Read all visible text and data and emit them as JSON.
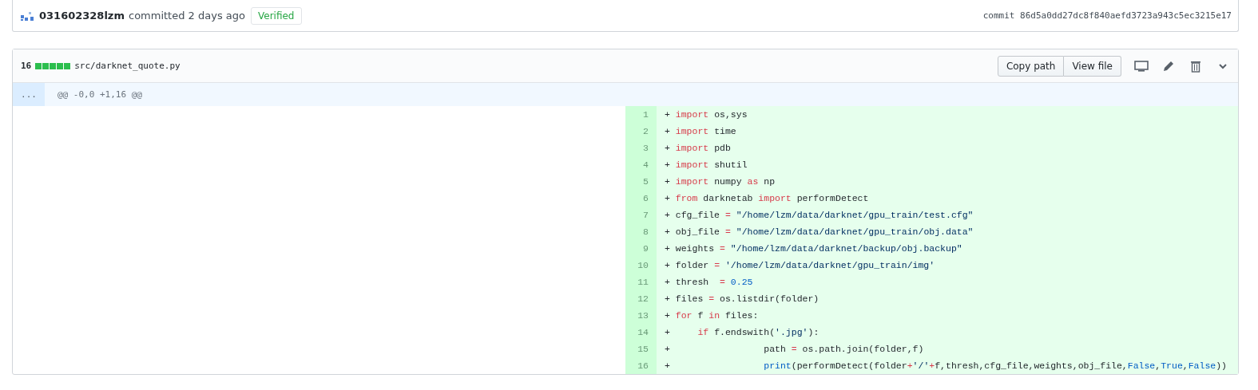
{
  "commit": {
    "author": "031602328lzm",
    "action": "committed 2 days ago",
    "badge": "Verified",
    "hash": "commit 86d5a0dd27dc8f840aefd3723a943c5ec3215e17"
  },
  "file": {
    "count": "16",
    "diffstat": [
      {
        "kind": "added"
      },
      {
        "kind": "added"
      },
      {
        "kind": "added"
      },
      {
        "kind": "added"
      },
      {
        "kind": "added"
      }
    ],
    "path": "src/darknet_quote.py",
    "buttons": [
      "Copy path",
      "View file"
    ]
  },
  "hunk": {
    "expander": "...",
    "header": "@@ -0,0 +1,16 @@"
  },
  "lines": [
    {
      "number": "1",
      "marker": "+",
      "tokens": [
        {
          "kind": "kw",
          "text": "import"
        },
        {
          "kind": "plain",
          "text": " os,sys"
        }
      ]
    },
    {
      "number": "2",
      "marker": "+",
      "tokens": [
        {
          "kind": "kw",
          "text": "import"
        },
        {
          "kind": "plain",
          "text": " time"
        }
      ]
    },
    {
      "number": "3",
      "marker": "+",
      "tokens": [
        {
          "kind": "kw",
          "text": "import"
        },
        {
          "kind": "plain",
          "text": " pdb"
        }
      ]
    },
    {
      "number": "4",
      "marker": "+",
      "tokens": [
        {
          "kind": "kw",
          "text": "import"
        },
        {
          "kind": "plain",
          "text": " shutil"
        }
      ]
    },
    {
      "number": "5",
      "marker": "+",
      "tokens": [
        {
          "kind": "kw",
          "text": "import"
        },
        {
          "kind": "plain",
          "text": " numpy "
        },
        {
          "kind": "kw",
          "text": "as"
        },
        {
          "kind": "plain",
          "text": " np"
        }
      ]
    },
    {
      "number": "6",
      "marker": "+",
      "tokens": [
        {
          "kind": "kw",
          "text": "from"
        },
        {
          "kind": "plain",
          "text": " darknetab "
        },
        {
          "kind": "kw",
          "text": "import"
        },
        {
          "kind": "plain",
          "text": " performDetect"
        }
      ]
    },
    {
      "number": "7",
      "marker": "+",
      "tokens": [
        {
          "kind": "plain",
          "text": "cfg_file "
        },
        {
          "kind": "kw",
          "text": "="
        },
        {
          "kind": "str",
          "text": " \"/home/lzm/data/darknet/gpu_train/test.cfg\""
        }
      ]
    },
    {
      "number": "8",
      "marker": "+",
      "tokens": [
        {
          "kind": "plain",
          "text": "obj_file "
        },
        {
          "kind": "kw",
          "text": "="
        },
        {
          "kind": "str",
          "text": " \"/home/lzm/data/darknet/gpu_train/obj.data\""
        }
      ]
    },
    {
      "number": "9",
      "marker": "+",
      "tokens": [
        {
          "kind": "plain",
          "text": "weights "
        },
        {
          "kind": "kw",
          "text": "="
        },
        {
          "kind": "str",
          "text": " \"/home/lzm/data/darknet/backup/obj.backup\""
        }
      ]
    },
    {
      "number": "10",
      "marker": "+",
      "tokens": [
        {
          "kind": "plain",
          "text": "folder "
        },
        {
          "kind": "kw",
          "text": "="
        },
        {
          "kind": "str",
          "text": " '/home/lzm/data/darknet/gpu_train/img'"
        }
      ]
    },
    {
      "number": "11",
      "marker": "+",
      "tokens": [
        {
          "kind": "plain",
          "text": "thresh  "
        },
        {
          "kind": "kw",
          "text": "="
        },
        {
          "kind": "num",
          "text": " 0.25"
        }
      ]
    },
    {
      "number": "12",
      "marker": "+",
      "tokens": [
        {
          "kind": "plain",
          "text": "files "
        },
        {
          "kind": "kw",
          "text": "="
        },
        {
          "kind": "plain",
          "text": " os.listdir(folder)"
        }
      ]
    },
    {
      "number": "13",
      "marker": "+",
      "tokens": [
        {
          "kind": "kw",
          "text": "for"
        },
        {
          "kind": "plain",
          "text": " f "
        },
        {
          "kind": "kw",
          "text": "in"
        },
        {
          "kind": "plain",
          "text": " files:"
        }
      ]
    },
    {
      "number": "14",
      "marker": "+",
      "tokens": [
        {
          "kind": "kw",
          "text": "    if"
        },
        {
          "kind": "plain",
          "text": " f.endswith("
        },
        {
          "kind": "str",
          "text": "'.jpg'"
        },
        {
          "kind": "plain",
          "text": "):"
        }
      ]
    },
    {
      "number": "15",
      "marker": "+",
      "tokens": [
        {
          "kind": "plain",
          "text": "                path "
        },
        {
          "kind": "kw",
          "text": "="
        },
        {
          "kind": "plain",
          "text": " os.path.join(folder,f)"
        }
      ]
    },
    {
      "number": "16",
      "marker": "+",
      "tokens": [
        {
          "kind": "num",
          "text": "                print"
        },
        {
          "kind": "plain",
          "text": "(performDetect(folder"
        },
        {
          "kind": "kw",
          "text": "+"
        },
        {
          "kind": "str",
          "text": "'/'"
        },
        {
          "kind": "kw",
          "text": "+"
        },
        {
          "kind": "plain",
          "text": "f,thresh,cfg_file,weights,obj_file,"
        },
        {
          "kind": "num",
          "text": "False"
        },
        {
          "kind": "plain",
          "text": ","
        },
        {
          "kind": "num",
          "text": "True"
        },
        {
          "kind": "plain",
          "text": ","
        },
        {
          "kind": "num",
          "text": "False"
        },
        {
          "kind": "plain",
          "text": "))"
        }
      ]
    }
  ]
}
